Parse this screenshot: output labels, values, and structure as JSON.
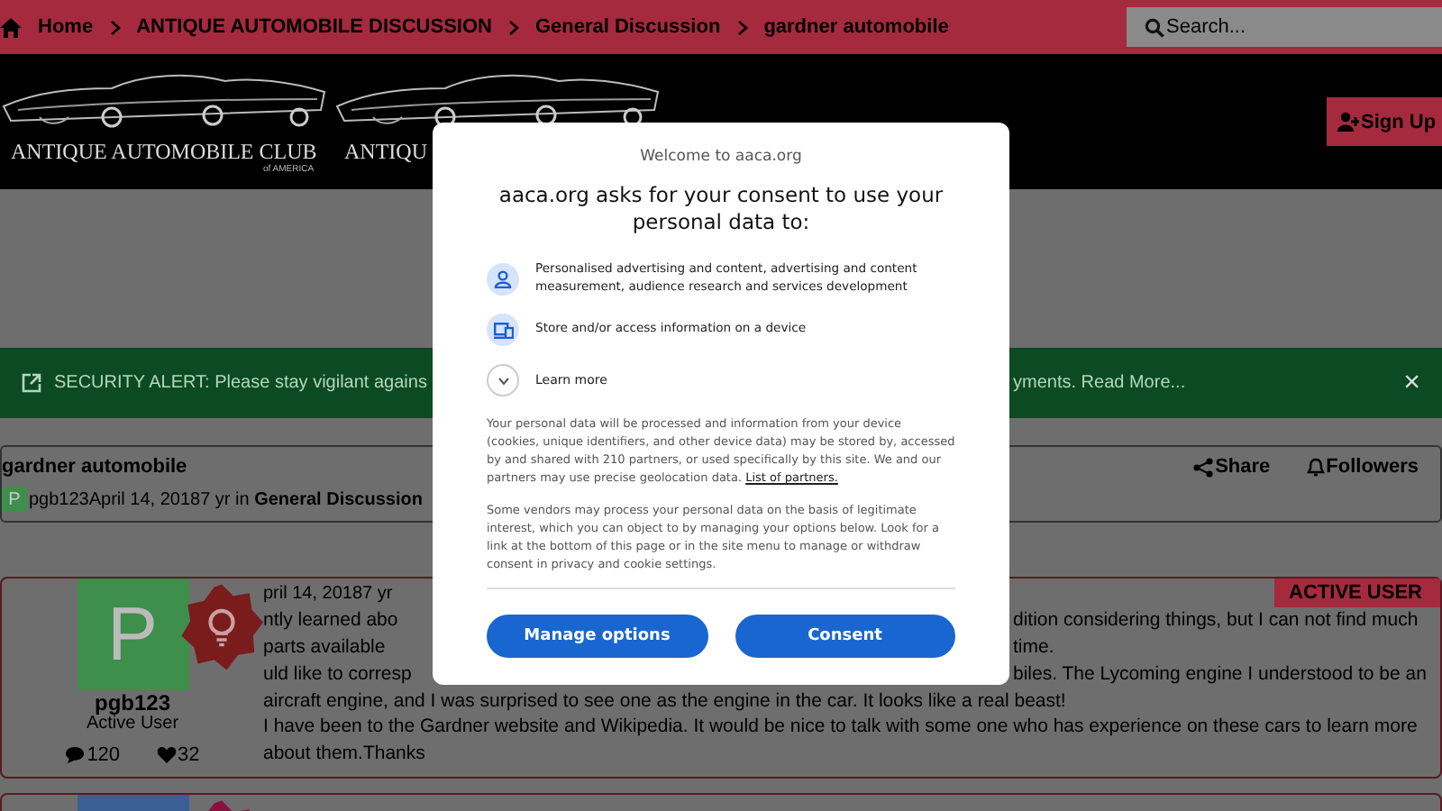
{
  "breadcrumbs": [
    {
      "label": "Home"
    },
    {
      "label": "ANTIQUE AUTOMOBILE DISCUSSION"
    },
    {
      "label": "General Discussion"
    },
    {
      "label": "gardner automobile"
    }
  ],
  "search": {
    "placeholder": "Search..."
  },
  "logos": [
    {
      "name": "ANTIQUE AUTOMOBILE CLUB",
      "tagline": "of AMERICA"
    },
    {
      "name": "ANTIQU"
    }
  ],
  "sign_up": "Sign Up",
  "alert": {
    "text_start": "SECURITY ALERT: Please stay vigilant agains",
    "text_end": "yments. Read More...",
    "close": "×"
  },
  "topic": {
    "title": "gardner automobile",
    "share": "Share",
    "followers": "Followers",
    "avatar_letter": "P",
    "byline": "pgb123April 14, 20187 yr in **General Discussion**"
  },
  "posts": [
    {
      "avatar_letter": "P",
      "color": "#3e8e4c",
      "badge": {
        "color": "#7a1c1c"
      },
      "author": "pgb123",
      "rank": "Active User",
      "comments": "120",
      "likes": "32",
      "tag": "ACTIVE USER",
      "lines": [
        {
          "left": "pril 14, 20187 yr"
        },
        {
          "left": "ntly learned abo",
          "right": "dition considering things, but I can not find much"
        },
        {
          "left": "parts available",
          "right": "time."
        },
        {
          "left": "uld like to corresp",
          "right": "biles. The Lycoming engine I understood to be an"
        },
        {
          "left": "aircraft engine, and I was surprised to see one as the  engine in the car. It looks like a real beast!"
        },
        {
          "left": "I have been to the Gardner website and Wikipedia. It would be nice to talk with some one who has experience on these cars to learn more about them.Thanks"
        }
      ]
    },
    {
      "color": "#3a5f95",
      "badge": {
        "color": "#8a1040"
      }
    }
  ],
  "consent": {
    "welcome": "Welcome to aaca.org",
    "heading": "aaca.org asks for your consent to use your personal data to:",
    "purposes": [
      {
        "kind": "person",
        "text": "Personalised advertising and content, advertising and content measurement, audience research and services development"
      },
      {
        "kind": "device",
        "text": "Store and/or access information on a device"
      }
    ],
    "learn_more": "Learn more",
    "paragraph_1": "Your personal data will be processed and information from your device (cookies, unique identifiers, and other device data) may be stored by, accessed by and shared with 210 partners, or used specifically by this site. We and our partners may use precise geolocation data.",
    "partners_link": "List of partners.",
    "paragraph_2": "Some vendors may process your personal data on the basis of legitimate interest, which you can object to by managing your options below. Look for a link at the bottom of this page or in the site menu to manage or withdraw consent in privacy and cookie settings.",
    "buttons": [
      "Manage options",
      "Consent"
    ]
  }
}
